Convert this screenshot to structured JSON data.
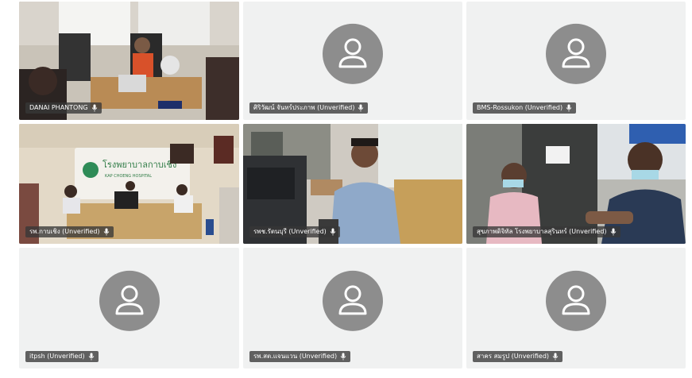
{
  "tiles": [
    {
      "name": "DANAI PHANTONG",
      "video": true
    },
    {
      "name": "ศิริวัฒน์ จันทร์ประภาพ (Unverified)",
      "video": false
    },
    {
      "name": "BMS-Rossukon (Unverified)",
      "video": false
    },
    {
      "name": "รพ.กาบเชิง (Unverified)",
      "video": true,
      "sign_text": "โรงพยาบาลกาบเชิง",
      "sign_subtext": "KAP CHOENG HOSPITAL"
    },
    {
      "name": "รพช.รัตนบุรี (Unverified)",
      "video": true
    },
    {
      "name": "สุขภาพดิจิทัล โรงพยาบาลสุรินทร์ (Unverified)",
      "video": true
    },
    {
      "name": "itpsh (Unverified)",
      "video": false
    },
    {
      "name": "รพ.สต.แจนแวน (Unverified)",
      "video": false
    },
    {
      "name": "สาคร สมรูป (Unverified)",
      "video": false
    }
  ],
  "icons": {
    "avatar": "person-icon",
    "mic": "microphone-muted-icon"
  }
}
